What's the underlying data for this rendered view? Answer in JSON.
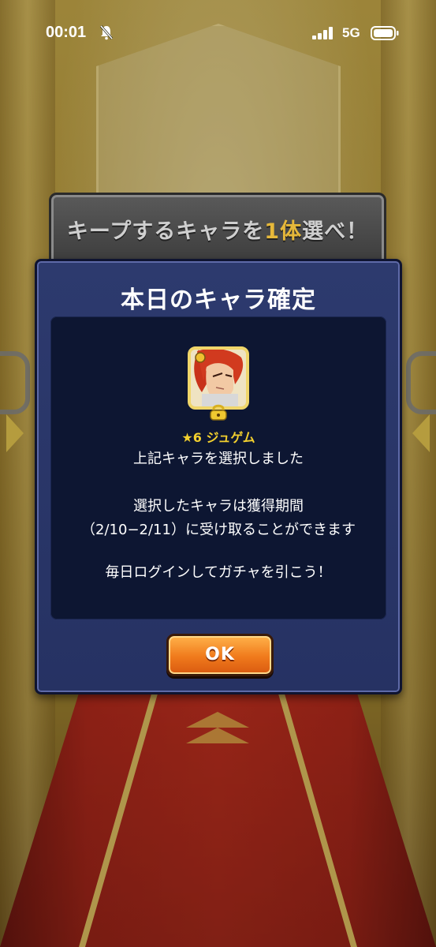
{
  "status_bar": {
    "time": "00:01",
    "network": "5G",
    "icons": [
      "bell-muted-icon",
      "signal-icon",
      "battery-icon"
    ]
  },
  "background_panel": {
    "title_prefix": "キープするキャラを",
    "title_count": "1体",
    "title_suffix": "選べ！"
  },
  "dialog": {
    "title": "本日のキャラ確定",
    "character": {
      "rarity": "★6",
      "name": "ジュゲム",
      "icons": [
        "character-portrait",
        "chain-lock-icon"
      ]
    },
    "message_selected": "上記キャラを選択しました",
    "message_period_line1": "選択したキャラは獲得期間",
    "message_period_line2": "（2/10−2/11）に受け取ることができます",
    "message_daily": "毎日ログインしてガチャを引こう！",
    "ok_label": "OK"
  },
  "colors": {
    "dialog_bg": "#2d3a6e",
    "dialog_inner": "#0d1632",
    "ok_orange": "#f07a1c",
    "star_gold": "#f2cf2e"
  }
}
